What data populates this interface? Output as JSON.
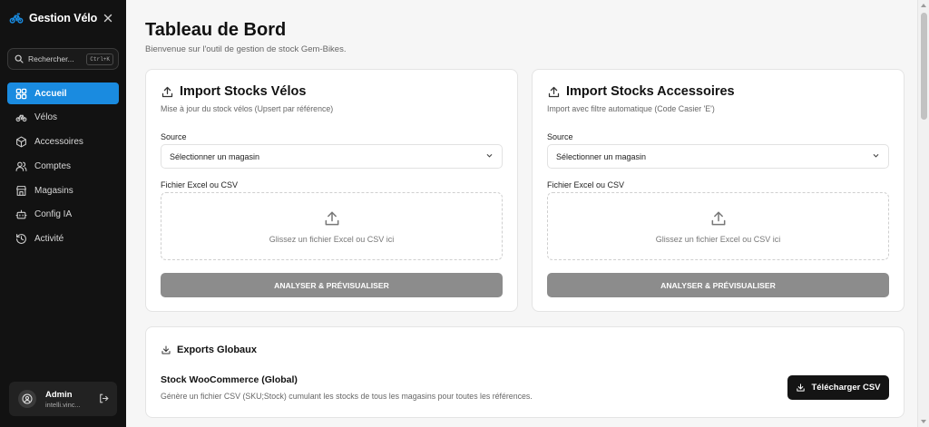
{
  "sidebar": {
    "brand": "Gestion Vélo",
    "search_placeholder": "Rechercher...",
    "search_shortcut": "Ctrl+K",
    "items": [
      {
        "label": "Accueil",
        "icon": "grid-icon",
        "active": true
      },
      {
        "label": "Vélos",
        "icon": "bike-icon"
      },
      {
        "label": "Accessoires",
        "icon": "box-icon"
      },
      {
        "label": "Comptes",
        "icon": "users-icon"
      },
      {
        "label": "Magasins",
        "icon": "store-icon"
      },
      {
        "label": "Config IA",
        "icon": "bot-icon"
      },
      {
        "label": "Activité",
        "icon": "history-icon"
      }
    ],
    "user": {
      "name": "Admin",
      "email": "intelli.vinc..."
    }
  },
  "main": {
    "title": "Tableau de Bord",
    "subtitle": "Bienvenue sur l'outil de gestion de stock Gem-Bikes.",
    "import_velos": {
      "title": "Import Stocks Vélos",
      "subtitle": "Mise à jour du stock vélos (Upsert par référence)",
      "source_label": "Source",
      "source_value": "Sélectionner un magasin",
      "file_label": "Fichier Excel ou CSV",
      "drop_text": "Glissez un fichier Excel ou CSV ici",
      "button": "ANALYSER & PRÉVISUALISER"
    },
    "import_accessoires": {
      "title": "Import Stocks Accessoires",
      "subtitle": "Import avec filtre automatique (Code Casier 'E')",
      "source_label": "Source",
      "source_value": "Sélectionner un magasin",
      "file_label": "Fichier Excel ou CSV",
      "drop_text": "Glissez un fichier Excel ou CSV ici",
      "button": "ANALYSER & PRÉVISUALISER"
    },
    "exports": {
      "title": "Exports Globaux",
      "item_name": "Stock WooCommerce (Global)",
      "item_desc": "Génère un fichier CSV (SKU;Stock) cumulant les stocks de tous les magasins pour toutes les références.",
      "button": "Télécharger CSV"
    }
  },
  "colors": {
    "accent": "#1a8be0",
    "sidebar_bg": "#121212",
    "button_gray": "#8c8c8c",
    "button_dark": "#141414"
  }
}
